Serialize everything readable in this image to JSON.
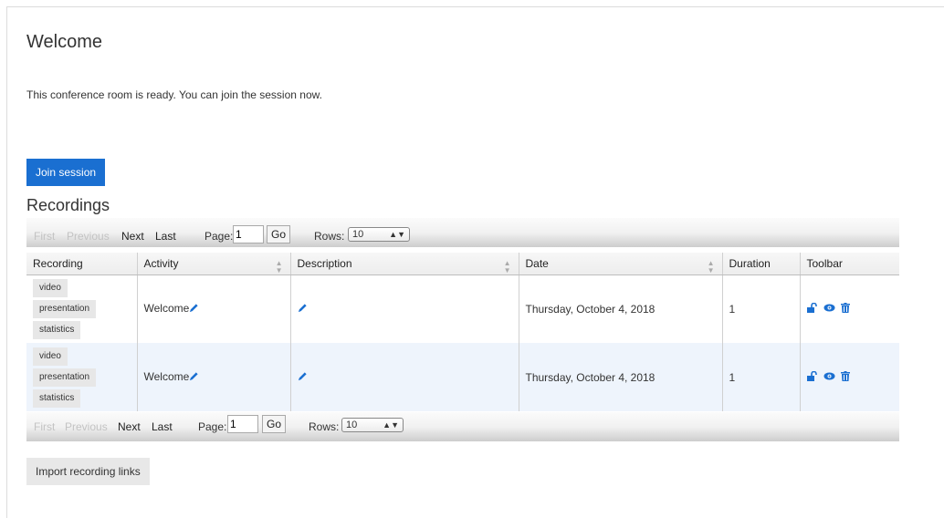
{
  "page": {
    "title": "Welcome",
    "intro": "This conference room is ready. You can join the session now.",
    "join_button": "Join session"
  },
  "recordings": {
    "title": "Recordings",
    "pager": {
      "first": "First",
      "previous": "Previous",
      "next": "Next",
      "last": "Last",
      "page_label": "Page:",
      "page_value": "1",
      "go": "Go",
      "rows_label": "Rows:",
      "rows_value": "10"
    },
    "columns": [
      "Recording",
      "Activity",
      "Description",
      "Date",
      "Duration",
      "Toolbar"
    ],
    "rows": [
      {
        "types": [
          "video",
          "presentation",
          "statistics"
        ],
        "activity": "Welcome",
        "description": "",
        "date": "Thursday, October 4, 2018",
        "duration": "1"
      },
      {
        "types": [
          "video",
          "presentation",
          "statistics"
        ],
        "activity": "Welcome",
        "description": "",
        "date": "Thursday, October 4, 2018",
        "duration": "1"
      }
    ],
    "import_button": "Import recording links"
  },
  "colors": {
    "accent": "#1a6fd1",
    "row_alt": "#eef4fc"
  },
  "icons": {
    "edit": "pencil-icon",
    "unlock": "unlock-icon",
    "view": "eye-icon",
    "delete": "trash-icon"
  }
}
